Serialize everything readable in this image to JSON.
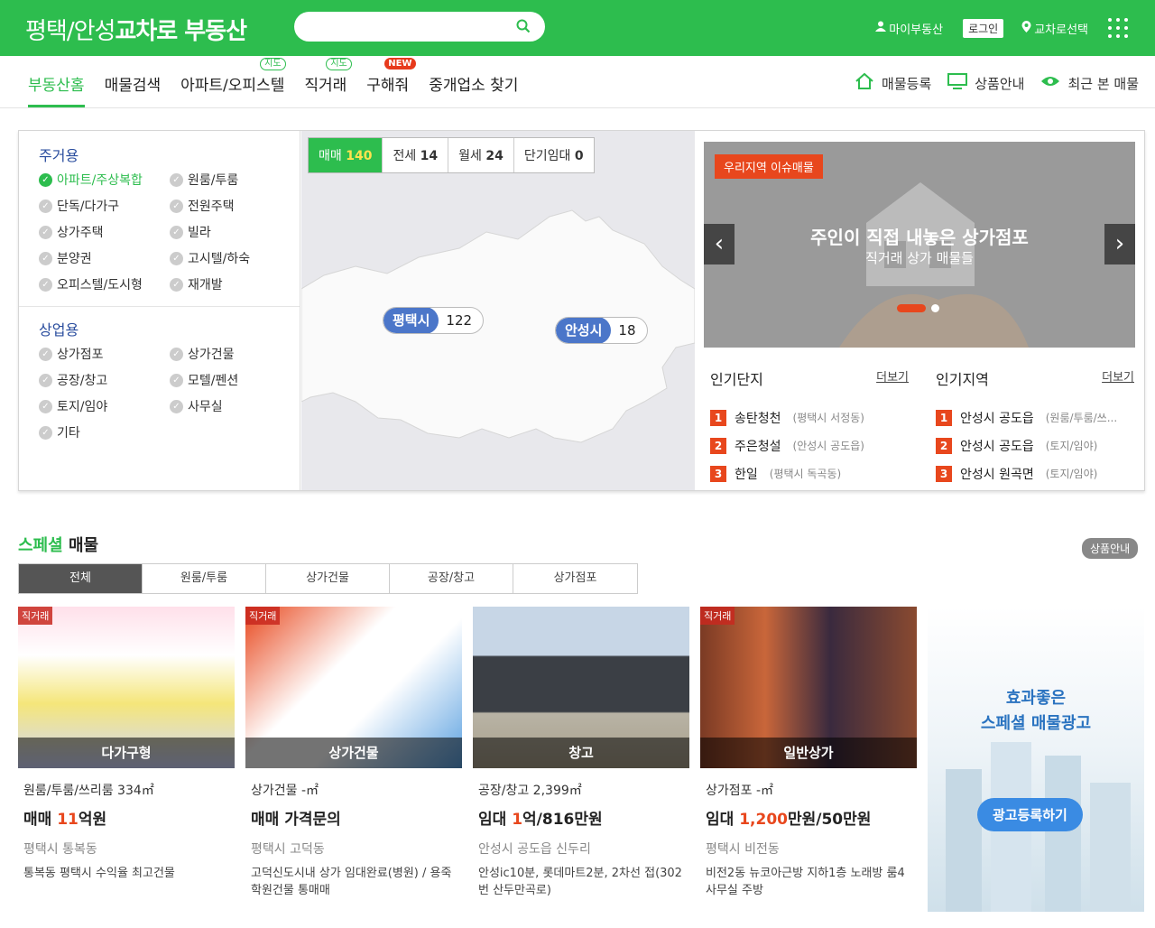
{
  "header": {
    "logo_prefix": "평택/안성",
    "logo_bold": "교차로 부동산",
    "my_estate": "마이부동산",
    "login": "로그인",
    "select": "교차로선택"
  },
  "nav": {
    "tabs": [
      "부동산홈",
      "매물검색",
      "아파트/오피스텔",
      "직거래",
      "구해줘",
      "중개업소 찾기"
    ],
    "badge_map": "지도",
    "badge_new": "NEW",
    "right": [
      "매물등록",
      "상품안내",
      "최근 본 매물"
    ]
  },
  "categories": {
    "residential_title": "주거용",
    "residential": [
      "아파트/주상복합",
      "원룸/투룸",
      "단독/다가구",
      "전원주택",
      "상가주택",
      "빌라",
      "분양권",
      "고시텔/하숙",
      "오피스텔/도시형",
      "재개발"
    ],
    "commercial_title": "상업용",
    "commercial": [
      "상가점포",
      "상가건물",
      "공장/창고",
      "모텔/펜션",
      "토지/임야",
      "사무실",
      "기타"
    ]
  },
  "deal_tabs": [
    {
      "label": "매매",
      "count": "140"
    },
    {
      "label": "전세",
      "count": "14"
    },
    {
      "label": "월세",
      "count": "24"
    },
    {
      "label": "단기임대",
      "count": "0"
    }
  ],
  "map_pins": [
    {
      "name": "평택시",
      "count": "122"
    },
    {
      "name": "안성시",
      "count": "18"
    }
  ],
  "banner": {
    "tag": "우리지역 이슈매물",
    "title": "주인이 직접 내놓은 상가점포",
    "subtitle": "직거래 상가 매물들"
  },
  "popular_complex": {
    "title": "인기단지",
    "more": "더보기",
    "items": [
      {
        "rank": "1",
        "name": "송탄청천",
        "sub": "(평택시 서정동)"
      },
      {
        "rank": "2",
        "name": "주은청설",
        "sub": "(안성시 공도읍)"
      },
      {
        "rank": "3",
        "name": "한일",
        "sub": "(평택시 독곡동)"
      }
    ]
  },
  "popular_region": {
    "title": "인기지역",
    "more": "더보기",
    "items": [
      {
        "rank": "1",
        "name": "안성시 공도읍",
        "sub": "(원룸/투룸/쓰..."
      },
      {
        "rank": "2",
        "name": "안성시 공도읍",
        "sub": "(토지/임야)"
      },
      {
        "rank": "3",
        "name": "안성시 원곡면",
        "sub": "(토지/임야)"
      }
    ]
  },
  "special": {
    "title_green": "스페셜",
    "title_rest": " 매물",
    "guide": "상품안내",
    "tabs": [
      "전체",
      "원룸/투룸",
      "상가건물",
      "공장/창고",
      "상가점포"
    ]
  },
  "cards": [
    {
      "direct": "직거래",
      "caption": "다가구형",
      "type": "원룸/투룸/쓰리룸 334㎡",
      "price_pre": "매매 ",
      "price_em": "11",
      "price_post": "억원",
      "loc": "평택시 통복동",
      "desc": "통복동 평택시 수익율 최고건물"
    },
    {
      "direct": "직거래",
      "caption": "상가건물",
      "type": "상가건물 -㎡",
      "price_pre": "매매 가격문의",
      "price_em": "",
      "price_post": "",
      "loc": "평택시 고덕동",
      "desc": "고덕신도시내 상가 임대완료(병원) / 용죽 학원건물 통매매"
    },
    {
      "direct": "",
      "caption": "창고",
      "type": "공장/창고 2,399㎡",
      "price_pre": "임대 ",
      "price_em": "1",
      "price_post": "억/816만원",
      "loc": "안성시 공도읍 신두리",
      "desc": "안성ic10분, 롯데마트2분, 2차선 접(302번 산두만곡로)"
    },
    {
      "direct": "직거래",
      "caption": "일반상가",
      "type": "상가점포 -㎡",
      "price_pre": "임대 ",
      "price_em": "1,200",
      "price_post": "만원/50만원",
      "loc": "평택시 비전동",
      "desc": "비전2동 뉴코아근방 지하1층 노래방 룸4 사무실 주방"
    }
  ],
  "ad": {
    "line1": "효과좋은",
    "line2": "스페셜 매물광고",
    "button": "광고등록하기"
  },
  "colors": {
    "brand_green": "#2dbd4e",
    "accent_red": "#e8471d",
    "pin_blue": "#4b76c9"
  }
}
